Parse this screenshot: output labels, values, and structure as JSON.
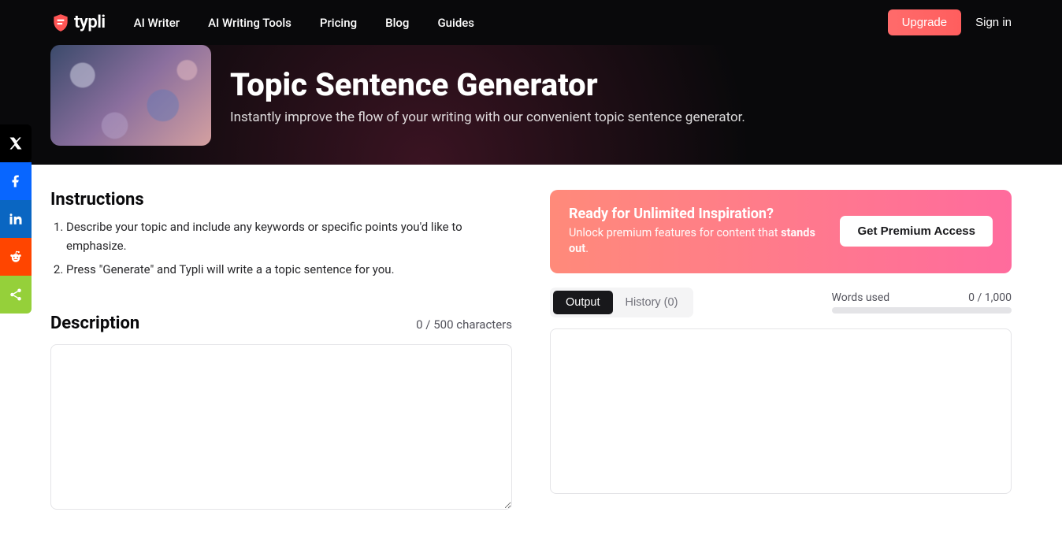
{
  "nav": {
    "logo_text": "typli",
    "links": [
      "AI Writer",
      "AI Writing Tools",
      "Pricing",
      "Blog",
      "Guides"
    ],
    "upgrade": "Upgrade",
    "signin": "Sign in"
  },
  "hero": {
    "title": "Topic Sentence Generator",
    "subtitle": "Instantly improve the flow of your writing with our convenient topic sentence generator."
  },
  "instructions": {
    "heading": "Instructions",
    "items": [
      "Describe your topic and include any keywords or specific points you'd like to emphasize.",
      "Press \"Generate\" and Typli will write a a topic sentence for you."
    ]
  },
  "description": {
    "heading": "Description",
    "char_count": "0 / 500 characters",
    "value": ""
  },
  "premium": {
    "heading": "Ready for Unlimited Inspiration?",
    "text_pre": "Unlock premium features for content that ",
    "text_strong": "stands out",
    "text_post": ".",
    "button": "Get Premium Access"
  },
  "output": {
    "tab_output": "Output",
    "tab_history": "History (0)",
    "words_label": "Words used",
    "words_value": "0 / 1,000"
  },
  "share": {
    "x": "x-icon",
    "facebook": "facebook-icon",
    "linkedin": "linkedin-icon",
    "reddit": "reddit-icon",
    "sharethis": "sharethis-icon"
  }
}
